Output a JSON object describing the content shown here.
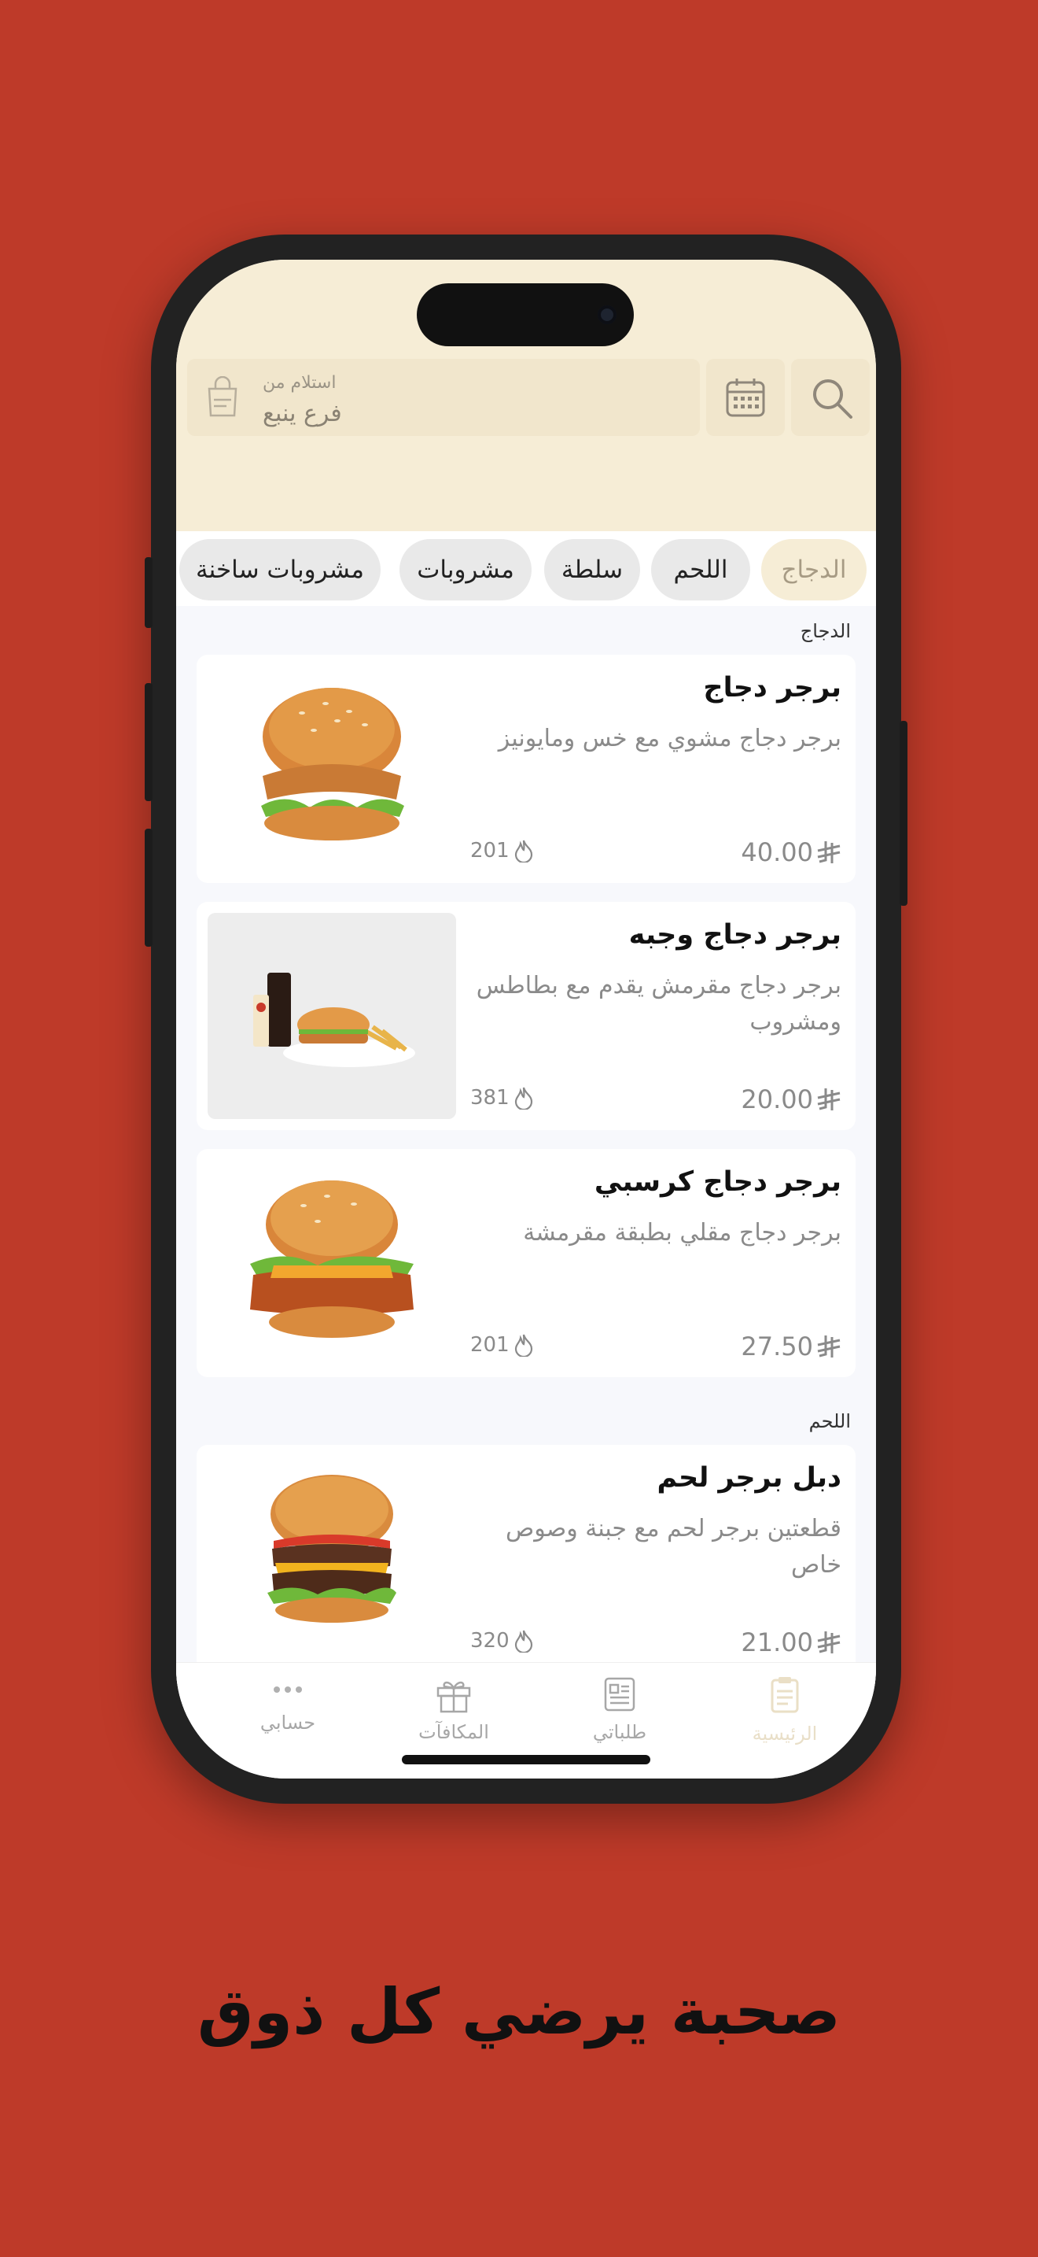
{
  "header": {
    "branch_label": "استلام من",
    "branch_value": "فرع ينبع"
  },
  "categories": [
    {
      "label": "الدجاج",
      "active": true
    },
    {
      "label": "اللحم",
      "active": false
    },
    {
      "label": "سلطة",
      "active": false
    },
    {
      "label": "مشروبات",
      "active": false
    },
    {
      "label": "مشروبات ساخنة",
      "active": false
    }
  ],
  "sections": [
    {
      "title": "الدجاج",
      "items": [
        {
          "name": "برجر دجاج",
          "description": "برجر دجاج مشوي مع خس ومايونيز",
          "price": "40.00",
          "calories": "201"
        },
        {
          "name": "برجر دجاج وجبه",
          "description": "برجر دجاج مقرمش يقدم مع بطاطس ومشروب",
          "price": "20.00",
          "calories": "381"
        },
        {
          "name": "برجر دجاج كرسبي",
          "description": "برجر دجاج مقلي بطبقة مقرمشة",
          "price": "27.50",
          "calories": "201"
        }
      ]
    },
    {
      "title": "اللحم",
      "items": [
        {
          "name": "دبل برجر لحم",
          "description": "قطعتين برجر لحم مع جبنة وصوص خاص",
          "price": "21.00",
          "calories": "320"
        }
      ]
    }
  ],
  "tabs": [
    {
      "label": "حسابي",
      "icon": "more-dots-icon"
    },
    {
      "label": "المكافآت",
      "icon": "gift-icon"
    },
    {
      "label": "طلباتي",
      "icon": "receipt-icon"
    },
    {
      "label": "الرئيسية",
      "icon": "menu-icon",
      "active": true
    }
  ],
  "tagline": "صحبة يرضي كل ذوق",
  "colors": {
    "background": "#BE3A29",
    "accent": "#F6EDD6",
    "active_chip_text": "#A79B84"
  }
}
